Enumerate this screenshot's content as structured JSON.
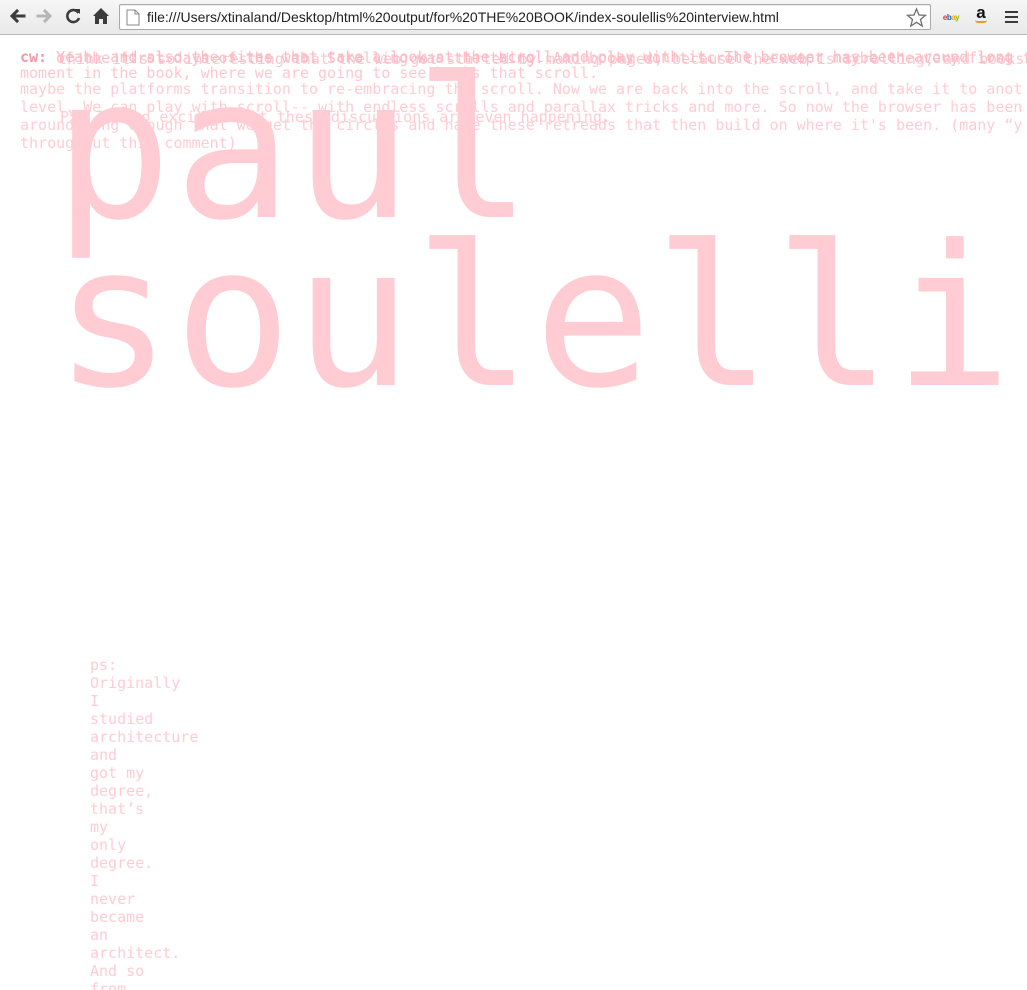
{
  "browser": {
    "url": "file:///Users/xtinaland/Desktop/html%20output/for%20THE%20BOOK/index-soulellis%20interview.html",
    "extensions": [
      "ebay",
      "a"
    ]
  },
  "page": {
    "overlay_label": "cw:",
    "overlay_lines": [
      "Yeah, and also the sites that take a look at the scroll and play with it. The browser has been around long enough that what we see are retreads and objects",
      "of the first days of the web. Scrolling was the thing. And books don't scroll, except maybe the very first form of the book, which was the scroll. I",
      "think it's so interesting that the web got started by making pages, because the web is scrolling, and books are pages, and this is a really interesting",
      "moment in the book, where we are going to see books that scroll."
    ],
    "body_lines": [
      "maybe the platforms transition to re-embracing the scroll. Now we are back into the scroll, and take it to another",
      "level. We can play with scroll-- with endless scrolls and parallax tricks and more. So now the browser has been",
      "around long enough that we get the circles and have these retreads that then build on where it's been. (many “yeah”s from PS",
      "throughout this comment)"
    ],
    "quote_line": "PS: I’m so excited that these discussions are even happening.",
    "name_lines": [
      "paul",
      "soulellis"
    ],
    "column_words": [
      "ps:",
      "Originally",
      "I",
      "studied",
      "architecture",
      "and",
      "got my",
      "degree,",
      "that’s",
      "my",
      "only",
      "degree.",
      "I",
      "never",
      "became",
      "an",
      "architect.",
      "And so",
      "from"
    ]
  },
  "colors": {
    "text_pink": "#ffccd3",
    "text_pink_dark": "#f29aa7",
    "background": "#ffffff"
  }
}
